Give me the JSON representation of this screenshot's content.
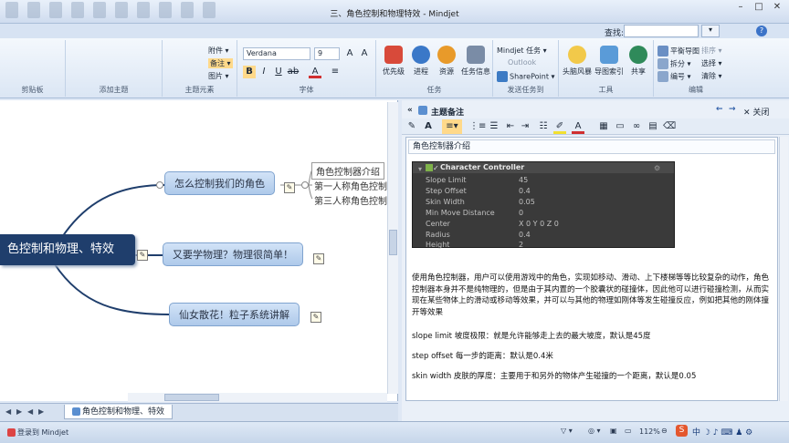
{
  "window": {
    "title": "三、角色控制和物理特效 - Mindjet"
  },
  "search": {
    "label": "查找:",
    "value": ""
  },
  "ribbon": {
    "groups": {
      "clipboard": "剪贴板",
      "add_topic": "添加主题",
      "topic_elements": "主题元素",
      "font": "字体",
      "tasks": "任务",
      "send_to": "发送任务到",
      "tools": "工具",
      "edit": "编辑"
    },
    "topic_elements": {
      "attachment": "附件",
      "notes": "备注",
      "image": "图片"
    },
    "font": {
      "family": "Verdana",
      "size": "9"
    },
    "tasks": {
      "priority": "优先级",
      "progress": "进程",
      "resources": "资源",
      "task_info": "任务信息"
    },
    "send_to": {
      "mindjet_tasks": "Mindjet 任务",
      "outlook": "Outlook",
      "sharepoint": "SharePoint"
    },
    "tools": {
      "brainstorm": "头脑风暴",
      "map_index": "导图索引",
      "share": "共享"
    },
    "edit": {
      "balance_map": "平衡导图",
      "split": "拆分",
      "numbering": "编号",
      "sort": "排序",
      "select": "选择",
      "clear": "清除"
    }
  },
  "mindmap": {
    "central": "色控制和物理、特效",
    "topics": [
      {
        "label": "怎么控制我们的角色"
      },
      {
        "label": "又要学物理？物理很简单！"
      },
      {
        "label": "仙女散花！粒子系统讲解"
      }
    ],
    "subtopics": [
      "角色控制器介绍",
      "第一人称角色控制",
      "第三人称角色控制"
    ]
  },
  "tabs": {
    "active": "角色控制和物理、特效"
  },
  "notes_panel": {
    "title": "主题备注",
    "close_label": "关闭",
    "note_title": "角色控制器介绍",
    "component": {
      "name": "Character Controller",
      "fields": [
        {
          "label": "Slope Limit",
          "value": "45"
        },
        {
          "label": "Step Offset",
          "value": "0.4"
        },
        {
          "label": "Skin Width",
          "value": "0.05"
        },
        {
          "label": "Min Move Distance",
          "value": "0"
        },
        {
          "label": "Center",
          "value": "X 0          Y 0          Z 0"
        },
        {
          "label": "Radius",
          "value": "0.4"
        },
        {
          "label": "Height",
          "value": "2"
        }
      ]
    },
    "paragraphs": [
      "使用角色控制器，用户可以使用游戏中的角色，实现如移动、滑动、上下楼梯等等比较复杂的动作，角色控制器本身并不是纯物理的，但是由于其内置的一个胶囊状的碰撞体，因此他可以进行碰撞检测，从而实现在某些物体上的滑动或移动等效果，并可以与其他的物理如刚体等发生碰撞反应，例如把其他的刚体撞开等效果",
      "slope limit 坡度极限：就是允许能够走上去的最大坡度，默认是45度",
      "step offset 每一步的距离：默认是0.4米",
      "skin width 皮肤的厚度：主要用于和另外的物体产生碰撞的一个距离，默认是0.05"
    ]
  },
  "status": {
    "login": "登录到 Mindjet",
    "zoom": "112%"
  }
}
